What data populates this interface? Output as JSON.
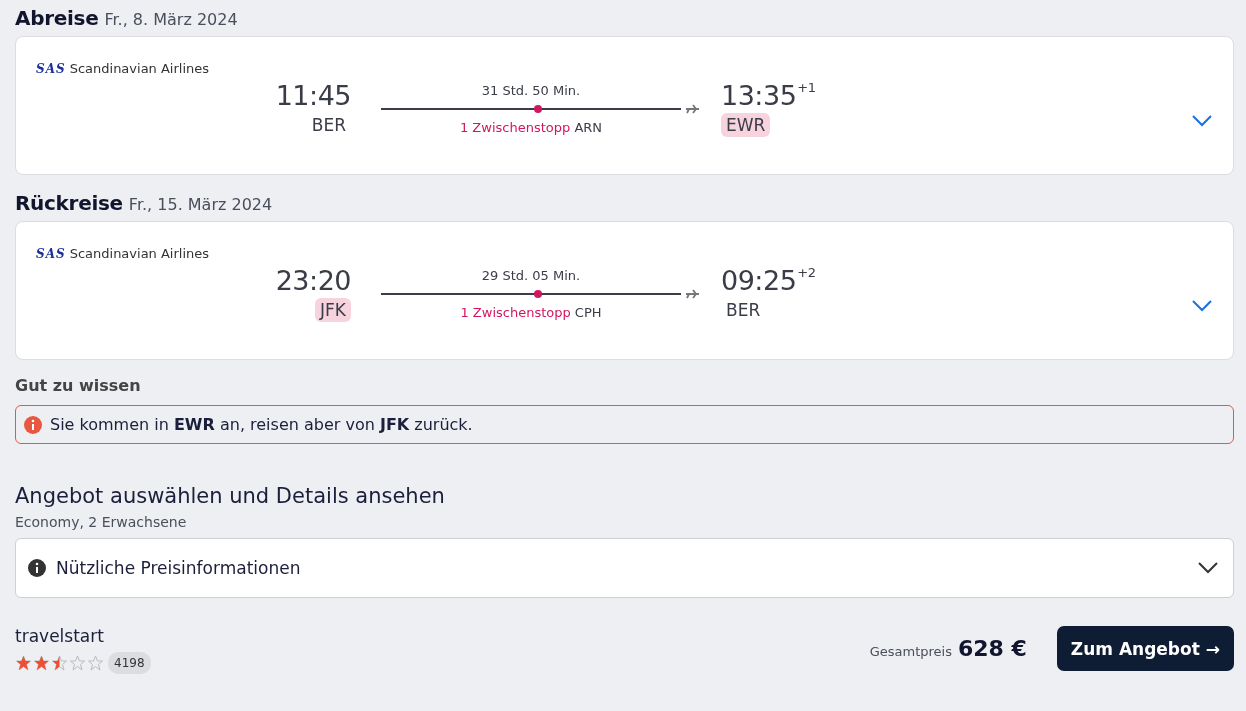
{
  "legs": [
    {
      "title": "Abreise",
      "date": "Fr., 8. März 2024",
      "airline": {
        "logo": "SAS",
        "name": "Scandinavian Airlines"
      },
      "depart": {
        "time": "11:45",
        "airport": "BER",
        "highlighted": false
      },
      "duration": "31 Std. 50 Min.",
      "stops": "1 Zwischenstopp",
      "stop_airport": "ARN",
      "arrive": {
        "time": "13:35",
        "day_offset": "+1",
        "airport": "EWR",
        "highlighted": true
      },
      "expanded": false
    },
    {
      "title": "Rückreise",
      "date": "Fr., 15. März 2024",
      "airline": {
        "logo": "SAS",
        "name": "Scandinavian Airlines"
      },
      "depart": {
        "time": "23:20",
        "airport": "JFK",
        "highlighted": true
      },
      "duration": "29 Std. 05 Min.",
      "stops": "1 Zwischenstopp",
      "stop_airport": "CPH",
      "arrive": {
        "time": "09:25",
        "day_offset": "+2",
        "airport": "BER",
        "highlighted": false
      },
      "expanded": false
    }
  ],
  "notice": {
    "heading": "Gut zu wissen",
    "text": "Sie kommen in **EWR** an, reisen aber von **JFK** zurück."
  },
  "offer": {
    "heading": "Angebot auswählen und Details ansehen",
    "subtitle": "Economy, 2 Erwachsene",
    "price_info": {
      "label": "Nützliche Preisinformationen",
      "expanded": false
    },
    "provider": "travelstart",
    "stars": 2.5,
    "reviews": "4198",
    "price_label": "Gesamtpreis",
    "price": "628 €",
    "button": "Zum Angebot →"
  }
}
